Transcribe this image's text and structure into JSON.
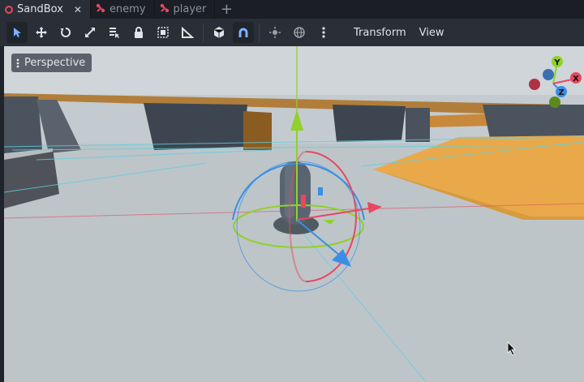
{
  "tabs": [
    {
      "label": "SandBox",
      "icon": "scene-node-icon",
      "active": true,
      "close": "✕"
    },
    {
      "label": "enemy",
      "icon": "bones-icon",
      "active": false
    },
    {
      "label": "player",
      "icon": "bones-icon",
      "active": false
    }
  ],
  "add_tab": "+",
  "toolbar": {
    "tools": [
      {
        "name": "select-tool",
        "icon": "arrow-cursor-icon",
        "active": true
      },
      {
        "name": "move-tool",
        "icon": "move-arrows-icon",
        "active": false
      },
      {
        "name": "rotate-tool",
        "icon": "rotate-icon",
        "active": false
      },
      {
        "name": "scale-tool",
        "icon": "scale-icon",
        "active": false
      },
      {
        "name": "list-select-tool",
        "icon": "list-select-icon",
        "active": false
      },
      {
        "name": "lock-tool",
        "icon": "lock-icon",
        "active": false
      },
      {
        "name": "group-tool",
        "icon": "group-icon",
        "active": false
      },
      {
        "name": "ruler-tool",
        "icon": "ruler-icon",
        "active": false
      },
      {
        "name": "local-space-toggle",
        "icon": "cube-icon",
        "active": false
      },
      {
        "name": "snap-toggle",
        "icon": "magnet-icon",
        "active": true
      },
      {
        "name": "sun-toggle",
        "icon": "sun-icon",
        "active": false
      },
      {
        "name": "environment-toggle",
        "icon": "globe-icon",
        "active": false
      },
      {
        "name": "more-options",
        "icon": "vertical-dots-icon",
        "active": false
      }
    ],
    "menus": [
      "Transform",
      "View"
    ]
  },
  "viewport": {
    "perspective_label": "Perspective",
    "gizmo": {
      "y": "Y",
      "x": "X",
      "z": "Z"
    },
    "colors": {
      "x": "#e8475f",
      "y": "#8fd12a",
      "z": "#3a8ee6",
      "floor": "#bcc4c8",
      "orange": "#e9a94a"
    }
  }
}
